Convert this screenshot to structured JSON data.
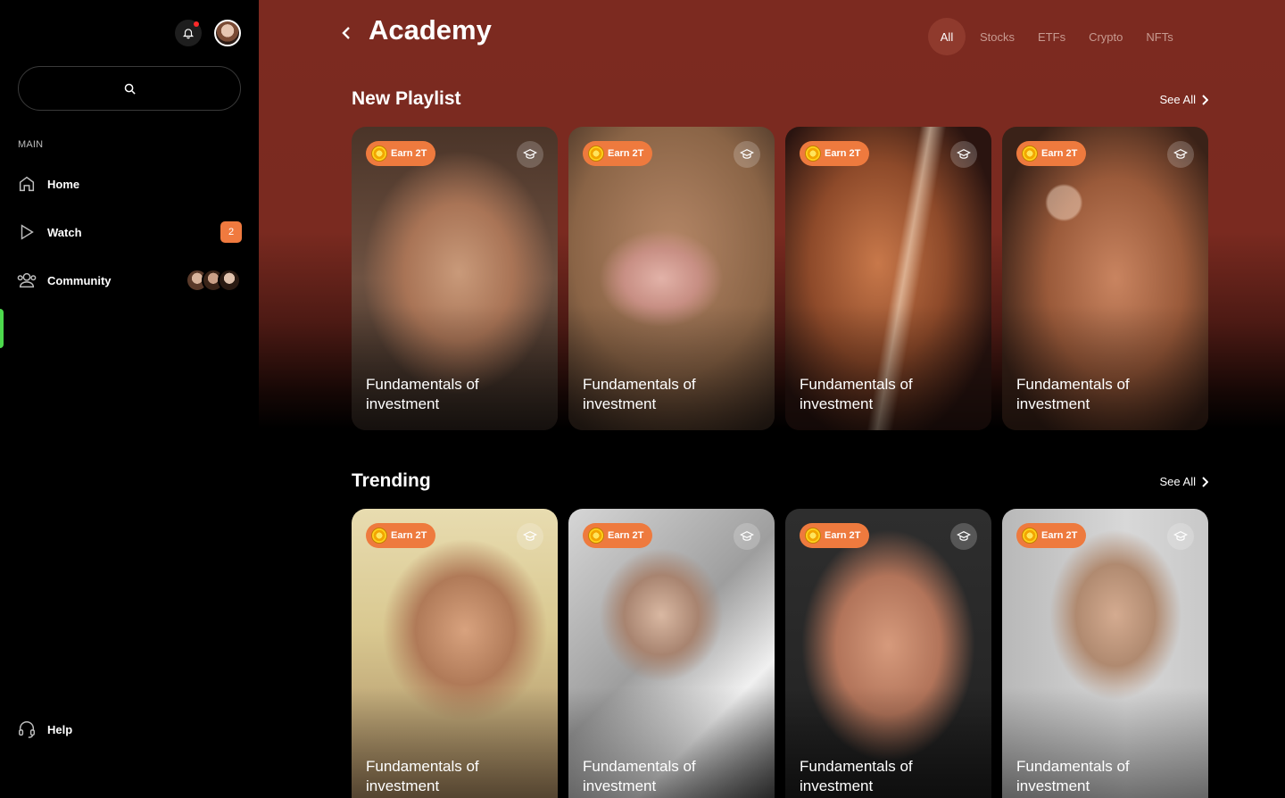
{
  "sidebar": {
    "section_label": "MAIN",
    "items": [
      {
        "label": "Home",
        "icon": "home-icon"
      },
      {
        "label": "Watch",
        "icon": "play-icon",
        "badge": "2"
      },
      {
        "label": "Community",
        "icon": "users-icon"
      }
    ],
    "help_label": "Help",
    "accent": "#4cd94c"
  },
  "header": {
    "title": "Academy",
    "tabs": [
      "All",
      "Stocks",
      "ETFs",
      "Crypto",
      "NFTs"
    ],
    "active_tab": "All"
  },
  "sections": [
    {
      "title": "New Playlist",
      "see_all": "See All",
      "cards": [
        {
          "badge": "Earn 2T",
          "title": "Fundamentals of investment"
        },
        {
          "badge": "Earn 2T",
          "title": "Fundamentals of investment"
        },
        {
          "badge": "Earn 2T",
          "title": "Fundamentals of investment"
        },
        {
          "badge": "Earn 2T",
          "title": "Fundamentals of investment"
        }
      ]
    },
    {
      "title": "Trending",
      "see_all": "See All",
      "cards": [
        {
          "badge": "Earn 2T",
          "title": "Fundamentals of investment"
        },
        {
          "badge": "Earn 2T",
          "title": "Fundamentals of investment"
        },
        {
          "badge": "Earn 2T",
          "title": "Fundamentals of investment"
        },
        {
          "badge": "Earn 2T",
          "title": "Fundamentals of investment"
        }
      ]
    }
  ],
  "colors": {
    "brand_orange": "#ee7a3e",
    "header_bg": "#7c2a20",
    "notification_dot": "#ff2a2a"
  }
}
